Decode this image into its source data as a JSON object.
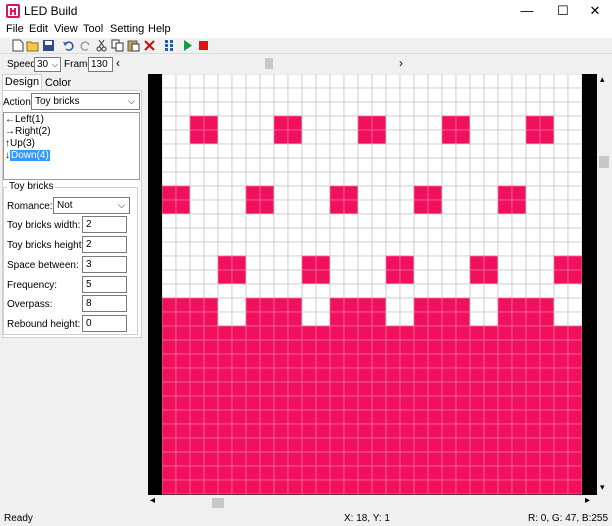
{
  "window": {
    "title": "LED Build",
    "minimize": "—",
    "maximize": "☐",
    "close": "✕"
  },
  "menu": [
    "File",
    "Edit",
    "View",
    "Tool",
    "Setting",
    "Help"
  ],
  "toolbar": [
    "new-icon",
    "open-icon",
    "save-icon",
    "undo-icon",
    "redo-icon",
    "cut-icon",
    "copy-icon",
    "paste-icon",
    "delete-icon",
    "grid-icon",
    "play-icon",
    "stop-icon"
  ],
  "controls": {
    "speed_label": "Speed:",
    "speed_value": "30",
    "frame_label": "Frame:",
    "frame_value": "130",
    "left_arrow": "‹",
    "right_arrow": "›"
  },
  "tabs": {
    "design": "Design",
    "color": "Color"
  },
  "action": {
    "label": "Action:",
    "value": "Toy bricks"
  },
  "directions": [
    {
      "arrow": "←",
      "label": "Left(1)"
    },
    {
      "arrow": "→",
      "label": "Right(2)"
    },
    {
      "arrow": "↑",
      "label": "Up(3)"
    },
    {
      "arrow": "↓",
      "label": "Down(4)"
    }
  ],
  "group": {
    "title": "Toy bricks",
    "romance_label": "Romance:",
    "romance_value": "Not",
    "props": [
      {
        "label": "Toy bricks width:",
        "value": "2"
      },
      {
        "label": "Toy bricks height:",
        "value": "2"
      },
      {
        "label": "Space between:",
        "value": "3"
      },
      {
        "label": "Frequency:",
        "value": "5"
      },
      {
        "label": "Overpass:",
        "value": "8"
      },
      {
        "label": "Rebound height:",
        "value": "0"
      }
    ]
  },
  "status": {
    "left": "Ready",
    "coords": "X: 18, Y: 1",
    "rgb": "R:  0, G: 47, B:255"
  },
  "colors": {
    "led_on": "#f0105e",
    "led_off": "#ffffff",
    "grid_line": "#c8c8c8",
    "border": "#000000"
  }
}
